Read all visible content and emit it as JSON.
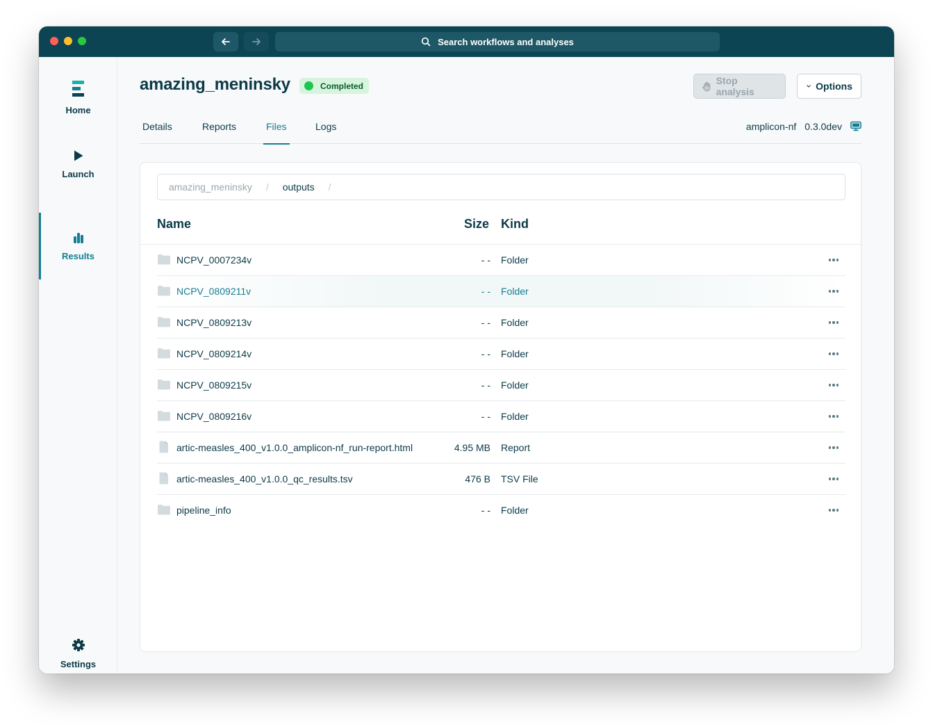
{
  "titlebar": {
    "search_placeholder": "Search workflows and analyses",
    "back_icon": "arrow-left-icon",
    "forward_icon": "arrow-right-icon"
  },
  "sidebar": {
    "items": [
      {
        "label": "Home",
        "icon": "logo-icon"
      },
      {
        "label": "Launch",
        "icon": "play-icon"
      },
      {
        "label": "Results",
        "icon": "bar-chart-icon",
        "active": true
      },
      {
        "label": "Settings",
        "icon": "gear-icon"
      }
    ]
  },
  "header": {
    "title": "amazing_meninsky",
    "status": "Completed",
    "stop_label": "Stop analysis",
    "options_label": "Options"
  },
  "tabs": [
    {
      "label": "Details"
    },
    {
      "label": "Reports"
    },
    {
      "label": "Files",
      "active": true
    },
    {
      "label": "Logs"
    }
  ],
  "meta": {
    "pipeline": "amplicon-nf",
    "version": "0.3.0dev"
  },
  "breadcrumb": {
    "root": "amazing_meninsky",
    "current": "outputs"
  },
  "table": {
    "headers": {
      "name": "Name",
      "size": "Size",
      "kind": "Kind"
    },
    "rows": [
      {
        "name": "NCPV_0007234v",
        "size": "- -",
        "kind": "Folder",
        "type": "folder"
      },
      {
        "name": "NCPV_0809211v",
        "size": "- -",
        "kind": "Folder",
        "type": "folder",
        "hover": true
      },
      {
        "name": "NCPV_0809213v",
        "size": "- -",
        "kind": "Folder",
        "type": "folder"
      },
      {
        "name": "NCPV_0809214v",
        "size": "- -",
        "kind": "Folder",
        "type": "folder"
      },
      {
        "name": "NCPV_0809215v",
        "size": "- -",
        "kind": "Folder",
        "type": "folder"
      },
      {
        "name": "NCPV_0809216v",
        "size": "- -",
        "kind": "Folder",
        "type": "folder"
      },
      {
        "name": "artic-measles_400_v1.0.0_amplicon-nf_run-report.html",
        "size": "4.95 MB",
        "kind": "Report",
        "type": "file"
      },
      {
        "name": "artic-measles_400_v1.0.0_qc_results.tsv",
        "size": "476 B",
        "kind": "TSV File",
        "type": "file"
      },
      {
        "name": "pipeline_info",
        "size": "- -",
        "kind": "Folder",
        "type": "folder"
      }
    ]
  },
  "colors": {
    "titlebar": "#0d4453",
    "accent": "#157d93",
    "text": "#0b3a48",
    "status_green": "#1fc553"
  }
}
